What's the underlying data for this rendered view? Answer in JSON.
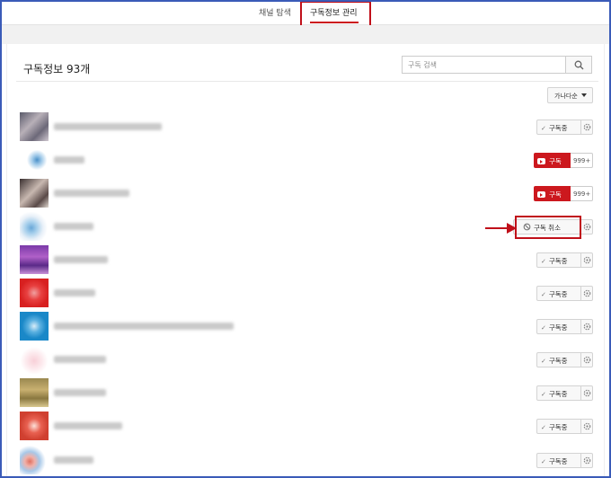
{
  "nav": {
    "tab_discover": "채널 탐색",
    "tab_manage": "구독정보 관리"
  },
  "header": {
    "title": "구독정보 93개",
    "search_placeholder": "구독 검색",
    "sort_label": "가나다순"
  },
  "buttons": {
    "subscribed": "구독중",
    "subscribe": "구독",
    "unsubscribe": "구독 취소",
    "count": "999+"
  },
  "icons": {
    "search": "search-icon",
    "gear": "gear-icon",
    "check": "check-icon",
    "youtube": "youtube-play-icon",
    "sort_caret": "caret-down-icon"
  },
  "colors": {
    "accent_red": "#cc181e",
    "highlight_red": "#c0101a",
    "frame_blue": "#3a5bb8"
  },
  "rows": [
    {
      "state": "subscribed"
    },
    {
      "state": "subscribe"
    },
    {
      "state": "subscribe"
    },
    {
      "state": "unsubscribe"
    },
    {
      "state": "subscribed"
    },
    {
      "state": "subscribed"
    },
    {
      "state": "subscribed"
    },
    {
      "state": "subscribed"
    },
    {
      "state": "subscribed"
    },
    {
      "state": "subscribed"
    },
    {
      "state": "subscribed"
    }
  ]
}
